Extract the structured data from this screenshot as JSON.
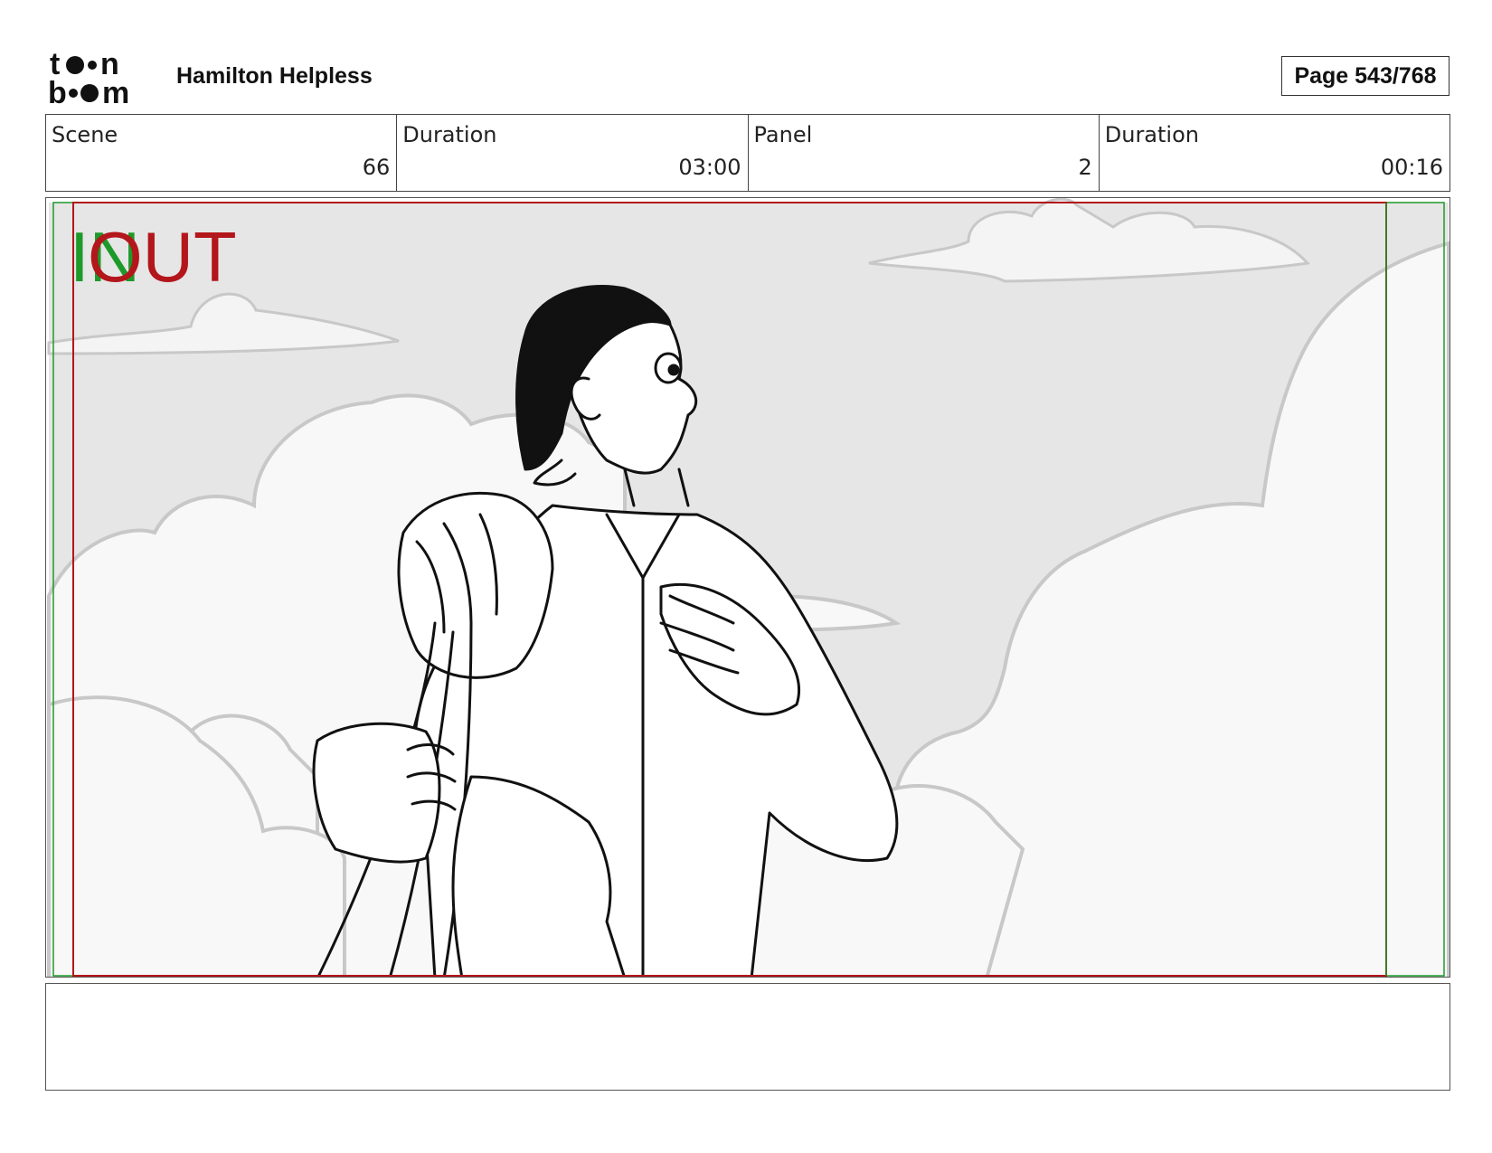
{
  "header": {
    "project_title": "Hamilton Helpless",
    "page_label": "Page 543/768",
    "logo": {
      "name": "toonboom-logo",
      "text": "toonboom"
    }
  },
  "info_row": [
    {
      "label": "Scene",
      "value": "66"
    },
    {
      "label": "Duration",
      "value": "03:00"
    },
    {
      "label": "Panel",
      "value": "2"
    },
    {
      "label": "Duration",
      "value": "00:16"
    }
  ],
  "panel": {
    "in_marker": "IN",
    "out_marker": "OUT",
    "colors": {
      "in_green": "#1d9a2a",
      "out_red": "#b3161b",
      "sky_gray": "#e6e6e6",
      "cloud_fill": "#f7f7f7",
      "cloud_line": "#c8c8c8",
      "ink": "#111111"
    }
  },
  "notes": {
    "text": ""
  }
}
